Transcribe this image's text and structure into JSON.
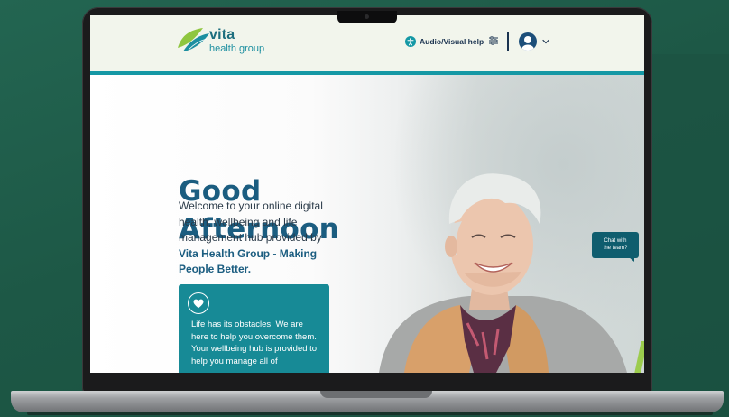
{
  "header": {
    "logo_primary": "vita",
    "logo_secondary": "health group",
    "audio_visual_help_label": "Audio/Visual help"
  },
  "hero": {
    "greeting_line1": "Good",
    "greeting_line2": "Afternoon",
    "intro_text": "Welcome to your online digital health, wellbeing and life management hub provided by",
    "intro_bold": "Vita Health Group - Making People Better."
  },
  "card": {
    "text": "Life has its obstacles. We are here to help you overcome them. Your wellbeing hub is provided to help you manage all of"
  },
  "chat": {
    "label_line1": "Chat with",
    "label_line2": "the team?"
  },
  "icons": {
    "accessibility": "accessibility-icon",
    "settings": "sliders-icon",
    "avatar": "user-avatar-icon",
    "chevron": "chevron-down-icon",
    "heart": "heart-icon"
  },
  "colors": {
    "background": "#1e5a47",
    "header_bg": "#f2f5ec",
    "accent_teal": "#1598a5",
    "heading_blue": "#1b5d80",
    "card_teal": "#178a96",
    "chat_bg": "#0f5d6e"
  }
}
